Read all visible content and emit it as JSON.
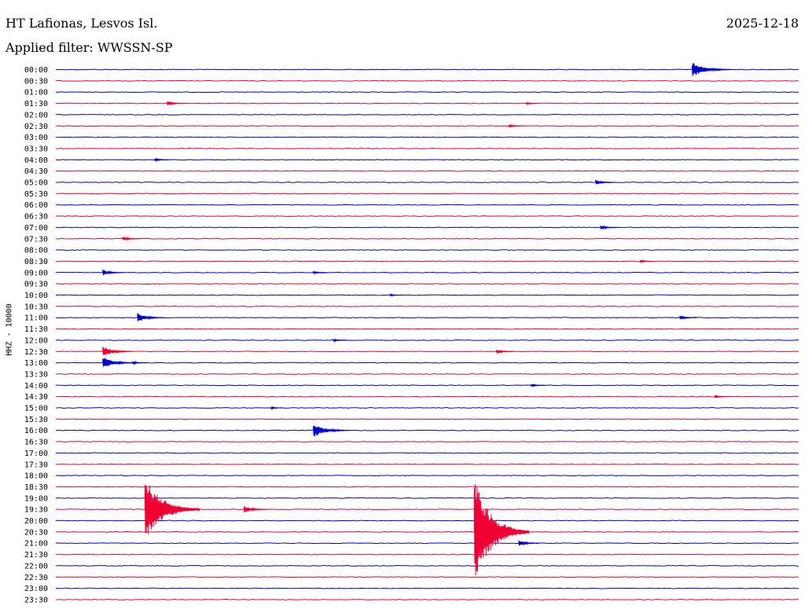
{
  "header": {
    "station": "HT Lafionas, Lesvos Isl.",
    "date": "2025-12-18",
    "filter_label": "Applied filter: WWSSN-SP"
  },
  "colors": {
    "even_trace": "#0000cc",
    "odd_trace": "#ee0033"
  },
  "chart_data": {
    "type": "line",
    "title": "",
    "xlabel": "",
    "ylabel": "HHZ - 10000",
    "grid": false,
    "rows": [
      "00:00",
      "00:30",
      "01:00",
      "01:30",
      "02:00",
      "02:30",
      "03:00",
      "03:30",
      "04:00",
      "04:30",
      "05:00",
      "05:30",
      "06:00",
      "06:30",
      "07:00",
      "07:30",
      "08:00",
      "08:30",
      "09:00",
      "09:30",
      "10:00",
      "10:30",
      "11:00",
      "11:30",
      "12:00",
      "12:30",
      "13:00",
      "13:30",
      "14:00",
      "14:30",
      "15:00",
      "15:30",
      "16:00",
      "16:30",
      "17:00",
      "17:30",
      "18:00",
      "18:30",
      "19:00",
      "19:30",
      "20:00",
      "20:30",
      "21:00",
      "21:30",
      "22:00",
      "22:30",
      "23:00",
      "23:30"
    ],
    "row_minutes": 30,
    "events": [
      {
        "row": "00:00",
        "minute": 25.7,
        "amplitude": 10
      },
      {
        "row": "01:30",
        "minute": 4.5,
        "amplitude": 3
      },
      {
        "row": "01:30",
        "minute": 19.0,
        "amplitude": 1.5
      },
      {
        "row": "02:30",
        "minute": 18.3,
        "amplitude": 2
      },
      {
        "row": "04:00",
        "minute": 4.0,
        "amplitude": 2
      },
      {
        "row": "05:00",
        "minute": 21.8,
        "amplitude": 3.5
      },
      {
        "row": "07:00",
        "minute": 22.0,
        "amplitude": 3
      },
      {
        "row": "07:30",
        "minute": 2.7,
        "amplitude": 3
      },
      {
        "row": "08:30",
        "minute": 23.6,
        "amplitude": 2
      },
      {
        "row": "09:00",
        "minute": 1.9,
        "amplitude": 4
      },
      {
        "row": "09:00",
        "minute": 10.4,
        "amplitude": 2
      },
      {
        "row": "10:00",
        "minute": 13.5,
        "amplitude": 1.5
      },
      {
        "row": "11:00",
        "minute": 3.3,
        "amplitude": 6
      },
      {
        "row": "11:00",
        "minute": 25.2,
        "amplitude": 3
      },
      {
        "row": "12:00",
        "minute": 11.2,
        "amplitude": 2
      },
      {
        "row": "12:30",
        "minute": 1.9,
        "amplitude": 7
      },
      {
        "row": "12:30",
        "minute": 17.8,
        "amplitude": 3
      },
      {
        "row": "13:00",
        "minute": 1.9,
        "amplitude": 8
      },
      {
        "row": "13:00",
        "minute": 3.1,
        "amplitude": 2
      },
      {
        "row": "14:00",
        "minute": 19.2,
        "amplitude": 2
      },
      {
        "row": "14:30",
        "minute": 26.6,
        "amplitude": 2
      },
      {
        "row": "15:00",
        "minute": 8.7,
        "amplitude": 1.5
      },
      {
        "row": "16:00",
        "minute": 10.4,
        "amplitude": 9
      },
      {
        "row": "19:30",
        "minute": 3.6,
        "amplitude": 42
      },
      {
        "row": "19:30",
        "minute": 7.6,
        "amplitude": 5
      },
      {
        "row": "20:30",
        "minute": 16.9,
        "amplitude": 70
      },
      {
        "row": "21:00",
        "minute": 18.7,
        "amplitude": 4
      }
    ]
  }
}
